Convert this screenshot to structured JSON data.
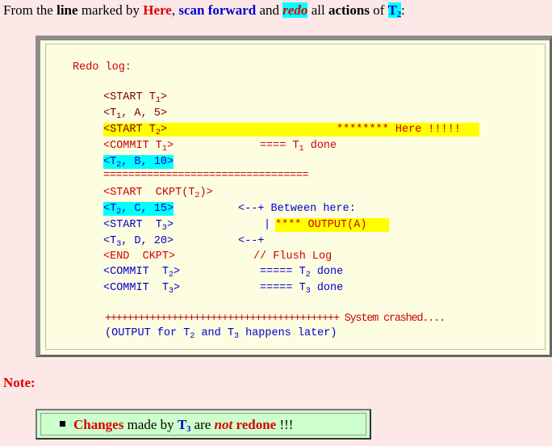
{
  "intro": {
    "p1": "From the ",
    "line": "line",
    "p2": " marked by ",
    "here": "Here",
    "p3": ", ",
    "scan_forward": "scan forward",
    "p4": " and ",
    "redo": "redo",
    "p5": " all ",
    "actions": "actions",
    "p6": " of ",
    "t": "T",
    "t_sub": "2",
    "p7": ":"
  },
  "redo_log": {
    "title": "Redo log:",
    "l1a": "<START T",
    "l1s": "1",
    "l1b": ">",
    "l2a": "<T",
    "l2s": "1",
    "l2b": ", A, 5>",
    "l3a": "<START T",
    "l3s": "2",
    "l3b": ">",
    "l3c": "******** Here !!!!!",
    "l4a": "<COMMIT T",
    "l4s": "1",
    "l4b": ">",
    "l4c": "==== T",
    "l4cs": "1",
    "l4d": " done",
    "l5a": "<T",
    "l5s": "2",
    "l5b": ", B, 10>",
    "sep": "=================================",
    "l6a": "<START  CKPT(T",
    "l6s": "2",
    "l6b": ")>",
    "l7a": "<T",
    "l7s": "2",
    "l7b": ", C, 15>",
    "l7c": "<--+ Between here:",
    "l8a": "<START  T",
    "l8s": "3",
    "l8b": ">",
    "l8c": "|",
    "l8d": "**** OUTPUT(A)",
    "l9a": "<T",
    "l9s": "3",
    "l9b": ", D, 20>",
    "l9c": "<--+",
    "l10a": "<END  CKPT>",
    "l10c": "// Flush Log",
    "l11a": "<COMMIT  T",
    "l11s": "2",
    "l11b": ">",
    "l11c": "===== T",
    "l11cs": "2",
    "l11d": " done",
    "l12a": "<COMMIT  T",
    "l12s": "3",
    "l12b": ">",
    "l12c": "===== T",
    "l12cs": "3",
    "l12d": " done",
    "crash": "++++++++++++++++++++++++++++++++++++++++++ System crashed....",
    "later_a": "(OUTPUT for T",
    "later_s1": "2",
    "later_b": " and T",
    "later_s2": "3",
    "later_c": " happens later)"
  },
  "note": {
    "title": "Note:",
    "changes": "Changes",
    "p1": " made by ",
    "t": "T",
    "t_sub": "3",
    "p2": " are ",
    "not": "not",
    "p3": " ",
    "redone": "redone",
    "p4": " !!!"
  }
}
